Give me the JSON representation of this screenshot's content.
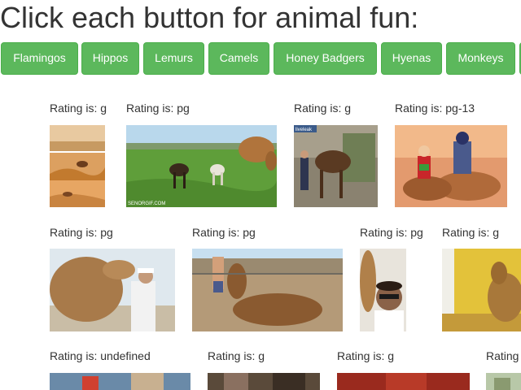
{
  "page": {
    "title": "Click each button for animal fun:"
  },
  "buttons": [
    {
      "label": "Flamingos"
    },
    {
      "label": "Hippos"
    },
    {
      "label": "Lemurs"
    },
    {
      "label": "Camels"
    },
    {
      "label": "Honey Badgers"
    },
    {
      "label": "Hyenas"
    },
    {
      "label": "Monkeys"
    }
  ],
  "ratings": [
    "Rating is: g",
    "Rating is: pg",
    "Rating is: g",
    "Rating is: pg-13",
    "Rating is: pg",
    "Rating is: pg",
    "Rating is: pg",
    "Rating is: g",
    "Rating is: undefined",
    "Rating is: g",
    "Rating is: g",
    "Rating"
  ],
  "watermarks": {
    "gif2": "SENORGIF.COM",
    "gif3": "liveleak"
  }
}
